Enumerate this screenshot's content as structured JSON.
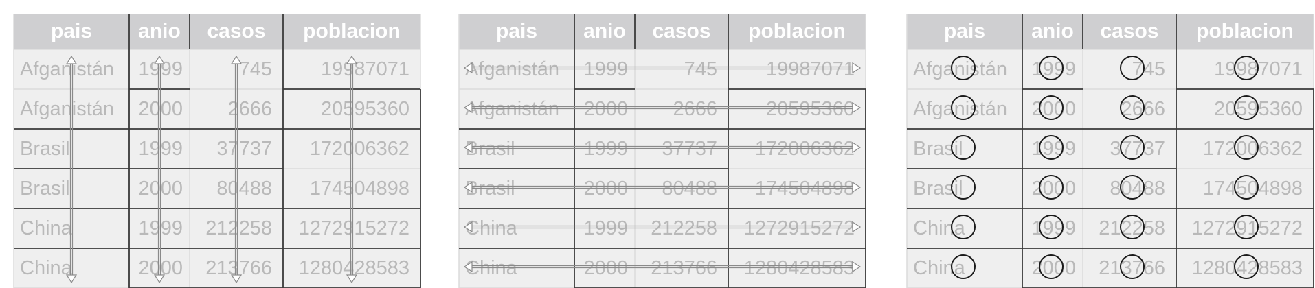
{
  "columns": [
    "pais",
    "anio",
    "casos",
    "poblacion"
  ],
  "rows": [
    [
      "Afganistán",
      "1999",
      "745",
      "19987071"
    ],
    [
      "Afganistán",
      "2000",
      "2666",
      "20595360"
    ],
    [
      "Brasil",
      "1999",
      "37737",
      "172006362"
    ],
    [
      "Brasil",
      "2000",
      "80488",
      "174504898"
    ],
    [
      "China",
      "1999",
      "212258",
      "1272915272"
    ],
    [
      "China",
      "2000",
      "213766",
      "1280428583"
    ]
  ],
  "panels": [
    {
      "id": "variables",
      "overlay": "vertical-arrows"
    },
    {
      "id": "observations",
      "overlay": "horizontal-arrows"
    },
    {
      "id": "values",
      "overlay": "circles"
    }
  ],
  "colors": {
    "header_bg": "#cfcfd1",
    "header_text": "#ffffff",
    "cell_bg": "#efefef",
    "cell_text": "#b9b9b9",
    "arrow": "#8a8a8a",
    "circle": "#1a1a1a",
    "grid_dark": "#3a3a3a"
  }
}
